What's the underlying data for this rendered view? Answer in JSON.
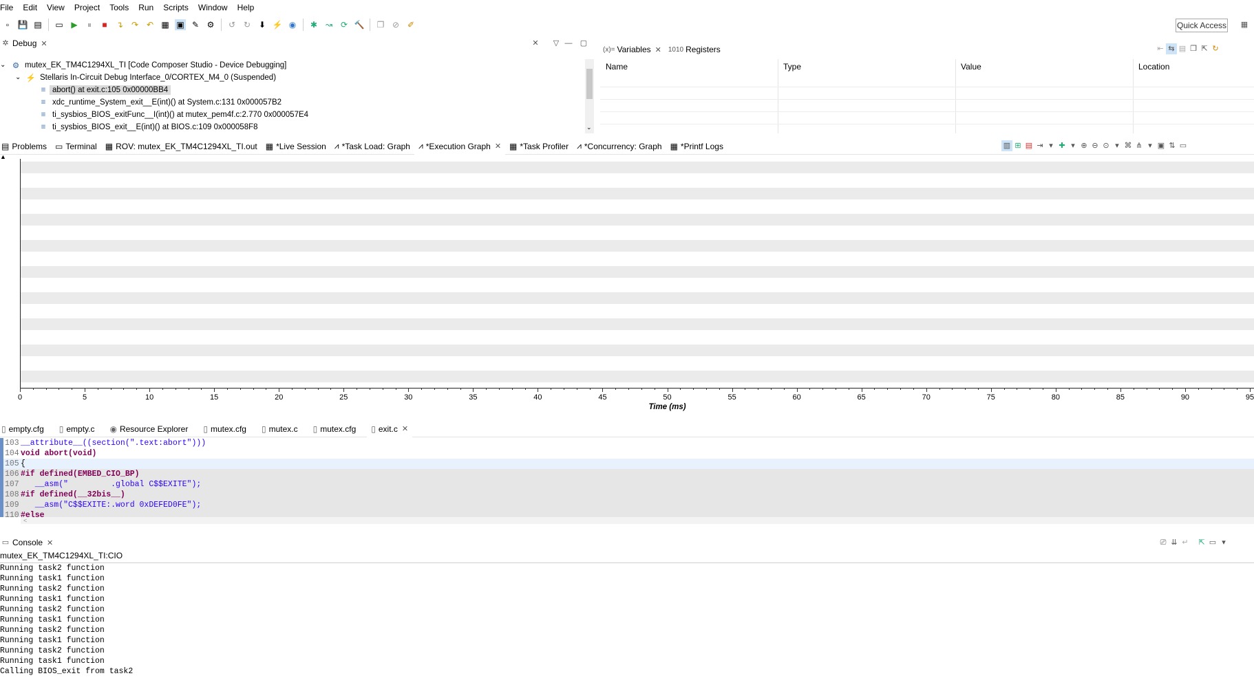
{
  "menu": [
    "File",
    "Edit",
    "View",
    "Project",
    "Tools",
    "Run",
    "Scripts",
    "Window",
    "Help"
  ],
  "quick_access": "Quick Access",
  "debug_panel": {
    "title": "Debug",
    "items": [
      {
        "label": "mutex_EK_TM4C1294XL_TI [Code Composer Studio - Device Debugging]"
      },
      {
        "label": "Stellaris In-Circuit Debug Interface_0/CORTEX_M4_0 (Suspended)"
      },
      {
        "label": "abort() at exit.c:105 0x00000BB4"
      },
      {
        "label": "xdc_runtime_System_exit__E(int)() at System.c:131 0x000057B2"
      },
      {
        "label": "ti_sysbios_BIOS_exitFunc__I(int)() at mutex_pem4f.c:2.770 0x000057E4"
      },
      {
        "label": "ti_sysbios_BIOS_exit__E(int)() at BIOS.c:109 0x000058F8"
      }
    ]
  },
  "variables_panel": {
    "tabs": [
      "Variables",
      "Registers"
    ],
    "tab_prefix": "(x)=",
    "columns": [
      "Name",
      "Type",
      "Value",
      "Location"
    ]
  },
  "analysis_tabs": [
    "Problems",
    "Terminal",
    "ROV: mutex_EK_TM4C1294XL_TI.out",
    "*Live Session",
    "*Task Load: Graph",
    "*Execution Graph",
    "*Task Profiler",
    "*Concurrency: Graph",
    "*Printf Logs"
  ],
  "chart_data": {
    "type": "line",
    "xlabel": "Time (ms)",
    "xlim": [
      0,
      95
    ],
    "x_ticks": [
      "0",
      "5",
      "10",
      "15",
      "20",
      "25",
      "30",
      "35",
      "40",
      "45",
      "50",
      "55",
      "60",
      "65",
      "70",
      "75",
      "80",
      "85",
      "90",
      "95"
    ],
    "series": [],
    "grid": true
  },
  "editor_tabs": [
    "empty.cfg",
    "empty.c",
    "Resource Explorer",
    "mutex.cfg",
    "mutex.c",
    "mutex.cfg",
    "exit.c"
  ],
  "code_lines": [
    {
      "num": "103",
      "text": "__attribute__((section(\".text:abort\")))"
    },
    {
      "num": "104",
      "text": "void abort(void)"
    },
    {
      "num": "105",
      "text": "{"
    },
    {
      "num": "106",
      "text": "#if defined(EMBED_CIO_BP)"
    },
    {
      "num": "107",
      "text": "   __asm(\"         .global C$$EXITE\");"
    },
    {
      "num": "108",
      "text": "#if defined(__32bis__)"
    },
    {
      "num": "109",
      "text": "   __asm(\"C$$EXITE:.word 0xDEFED0FE\");"
    },
    {
      "num": "110",
      "text": "#else"
    }
  ],
  "console": {
    "title": "Console",
    "source": "mutex_EK_TM4C1294XL_TI:CIO",
    "lines": [
      "Running task2 function",
      "Running task1 function",
      "Running task2 function",
      "Running task1 function",
      "Running task2 function",
      "Running task1 function",
      "Running task2 function",
      "Running task1 function",
      "Running task2 function",
      "Running task1 function",
      "Calling BIOS_exit from task2"
    ]
  },
  "colors": {
    "stripe": "#ebebeb",
    "selected": "#dadada",
    "code_highlight": "#e6e6e6",
    "current_line": "#e8f2fe",
    "keyword": "#7f0055",
    "string": "#2a00ff"
  }
}
